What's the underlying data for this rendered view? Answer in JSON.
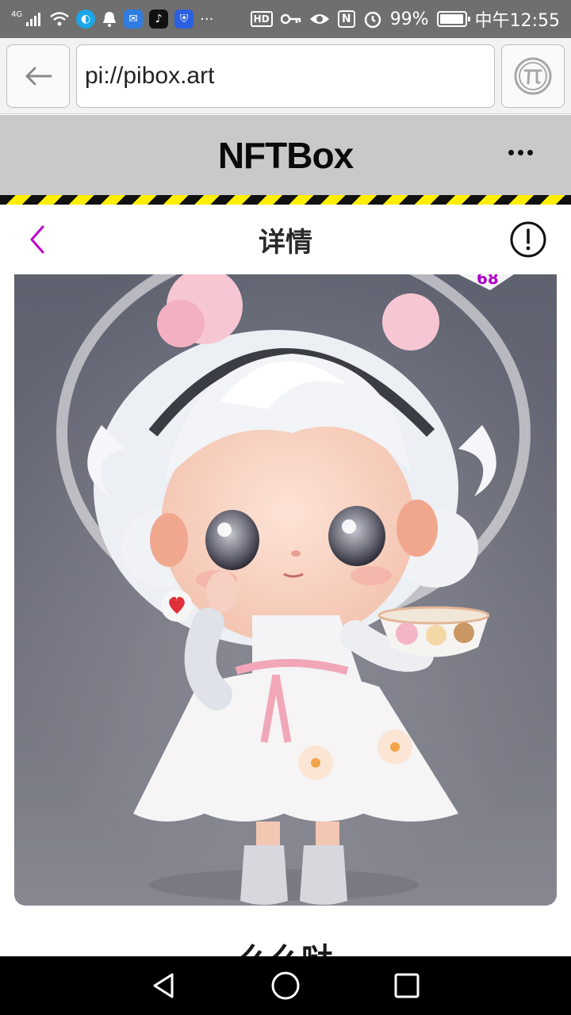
{
  "status_bar": {
    "network": "4G",
    "battery": "99%",
    "battery_level": 0.99,
    "time": "中午12:55",
    "hd": "HD",
    "nfc": "N",
    "more": "···"
  },
  "browser": {
    "url": "pi://pibox.art"
  },
  "app": {
    "title": "NFTBox"
  },
  "page": {
    "title": "详情",
    "image_corner_number": "68",
    "nft_name": "么么哒"
  },
  "colors": {
    "accent_back": "#c000c8",
    "hazard_yellow": "#ffee00",
    "header_bg": "#c9c9c9"
  }
}
